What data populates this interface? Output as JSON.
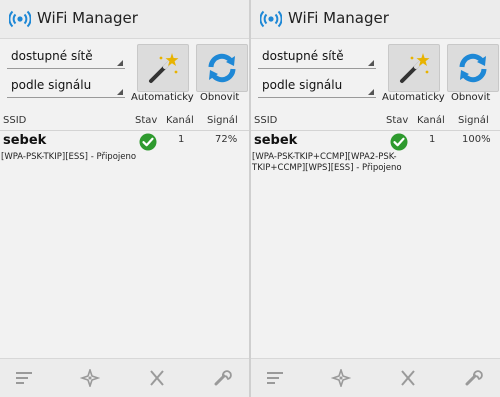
{
  "app": {
    "title": "WiFi Manager"
  },
  "filters": {
    "network_filter": "dostupné sítě",
    "sort_by": "podle signálu"
  },
  "buttons": {
    "auto_label": "Automaticky",
    "refresh_label": "Obnovit"
  },
  "columns": {
    "ssid": "SSID",
    "status": "Stav",
    "channel": "Kanál",
    "signal": "Signál"
  },
  "screens": [
    {
      "network": {
        "ssid": "sebek",
        "status_icon": "check-circle-icon",
        "channel": "1",
        "signal": "72%",
        "security": "[WPA-PSK-TKIP][ESS] - Připojeno"
      }
    },
    {
      "network": {
        "ssid": "sebek",
        "status_icon": "check-circle-icon",
        "channel": "1",
        "signal": "100%",
        "security": "[WPA-PSK-TKIP+CCMP][WPA2-PSK-TKIP+CCMP][WPS][ESS] - Připojeno"
      }
    }
  ],
  "bottom_icons": [
    "filter-lines-icon",
    "compass-icon",
    "close-icon",
    "wrench-icon"
  ],
  "colors": {
    "status_ok": "#2e9a2e",
    "refresh_blue": "#1e88d6",
    "wand_gold": "#e8b300"
  }
}
